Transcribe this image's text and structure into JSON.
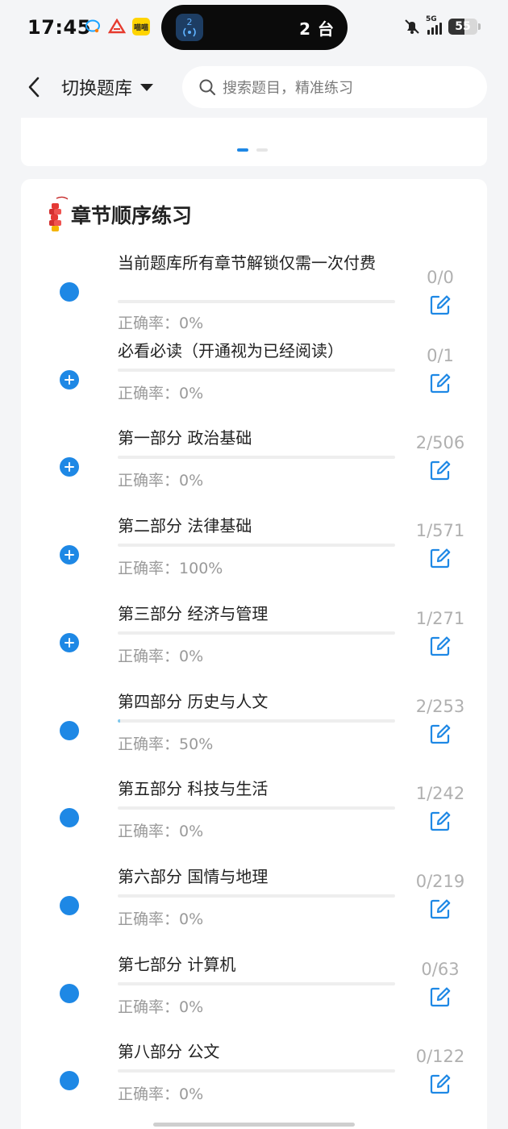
{
  "status_bar": {
    "time": "17:45",
    "notification_icons": [
      "chat-bubble-icon",
      "app-logo-icon",
      "yellow-app-icon"
    ],
    "yellow_app_text": "喵喵",
    "island_text": "2 台",
    "island_icon_number": "2",
    "network": "5G",
    "battery": "55",
    "battery_level": 0.55
  },
  "header": {
    "bank_switch_label": "切换题库",
    "search_placeholder": "搜索题目，精准练习"
  },
  "section": {
    "title": "章节顺序练习",
    "accuracy_prefix": "正确率："
  },
  "chapters": [
    {
      "title": "当前题库所有章节解锁仅需一次付费",
      "accuracy": "0%",
      "count": "0/0",
      "icon": "dot",
      "progress": 0
    },
    {
      "title": "必看必读（开通视为已经阅读）",
      "accuracy": "0%",
      "count": "0/1",
      "icon": "plus",
      "progress": 0
    },
    {
      "title": "第一部分 政治基础",
      "accuracy": "0%",
      "count": "2/506",
      "icon": "plus",
      "progress": 0
    },
    {
      "title": "第二部分 法律基础",
      "accuracy": "100%",
      "count": "1/571",
      "icon": "plus",
      "progress": 0
    },
    {
      "title": "第三部分 经济与管理",
      "accuracy": "0%",
      "count": "1/271",
      "icon": "plus",
      "progress": 0
    },
    {
      "title": "第四部分 历史与人文",
      "accuracy": "50%",
      "count": "2/253",
      "icon": "dot",
      "progress": 0.008
    },
    {
      "title": "第五部分 科技与生活",
      "accuracy": "0%",
      "count": "1/242",
      "icon": "dot",
      "progress": 0
    },
    {
      "title": "第六部分 国情与地理",
      "accuracy": "0%",
      "count": "0/219",
      "icon": "dot",
      "progress": 0
    },
    {
      "title": "第七部分 计算机",
      "accuracy": "0%",
      "count": "0/63",
      "icon": "dot",
      "progress": 0
    },
    {
      "title": "第八部分 公文",
      "accuracy": "0%",
      "count": "0/122",
      "icon": "dot",
      "progress": 0
    }
  ],
  "colors": {
    "accent": "#1e88e5",
    "progress": "#7fc7ec",
    "muted_text": "#9a9a9a"
  }
}
